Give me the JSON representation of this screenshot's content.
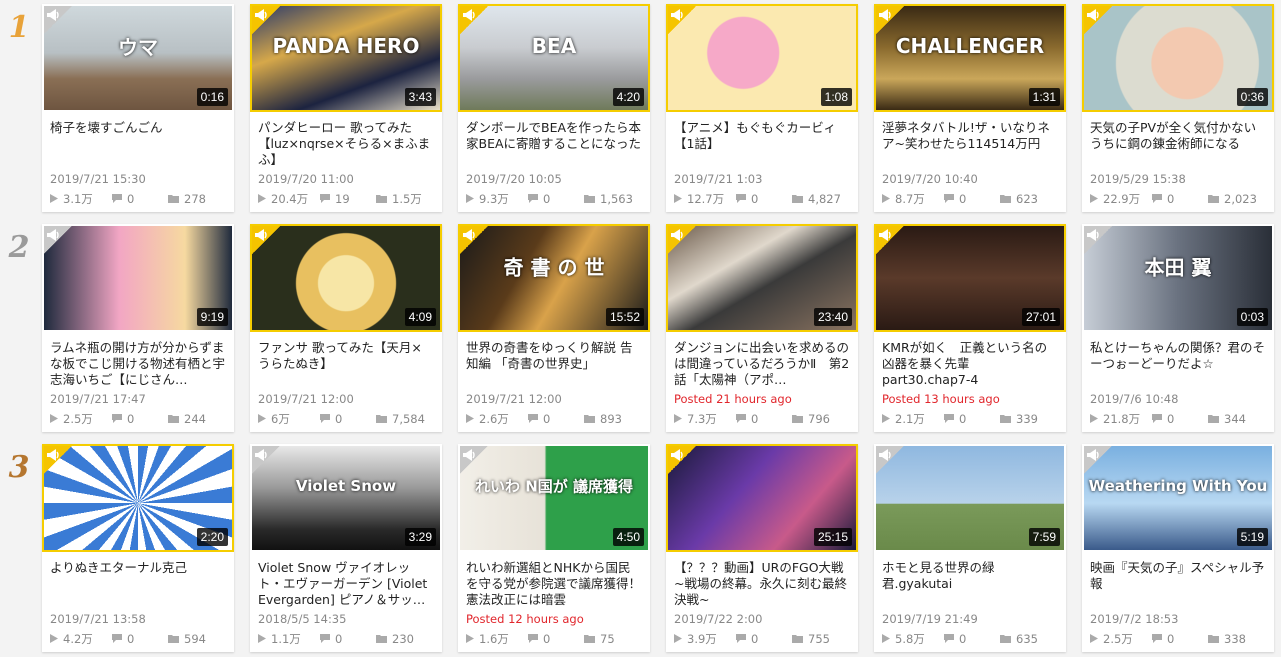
{
  "rows": [
    {
      "rank": "1",
      "color": "#e8a239",
      "cards": [
        {
          "title": "椅子を壊すごんごん",
          "date": "2019/7/21 15:30",
          "views": "3.1万",
          "comments": "0",
          "mylists": "278",
          "duration": "0:16",
          "ad": false,
          "new": false,
          "bg": "linear-gradient(180deg,#cfd8dc 0%,#b8c0c4 45%,#8a6f55 70%,#6e5540 100%)",
          "thumb_text": "ウマ",
          "icon": "megaphone-icon"
        },
        {
          "title": "パンダヒーロー 歌ってみた【luz×nqrse×そらる×まふまふ】",
          "date": "2019/7/20 11:00",
          "views": "20.4万",
          "comments": "19",
          "mylists": "1.5万",
          "duration": "3:43",
          "ad": true,
          "new": false,
          "bg": "linear-gradient(160deg,#2b3a6a 0%,#d6a84a 35%,#1c2340 70%,#e9e0c9 100%)",
          "thumb_text": "PANDA HERO",
          "icon": "megaphone-icon"
        },
        {
          "title": "ダンボールでBEAを作ったら本家BEAに寄贈することになった",
          "date": "2019/7/20 10:05",
          "views": "9.3万",
          "comments": "0",
          "mylists": "1,563",
          "duration": "4:20",
          "ad": true,
          "new": false,
          "bg": "linear-gradient(180deg,#dfe6ec 0%,#c9ccd0 40%,#9a9b9d 70%,#6f7a5a 100%)",
          "thumb_text": "BEA",
          "icon": "megaphone-icon"
        },
        {
          "title": "【アニメ】もぐもぐカービィ【1話】",
          "date": "2019/7/21 1:03",
          "views": "12.7万",
          "comments": "0",
          "mylists": "4,827",
          "duration": "1:08",
          "ad": true,
          "new": false,
          "bg": "radial-gradient(circle at 40% 45%,#f6a9c8 0 28%,#fbe9b0 29% 100%)",
          "thumb_text": "",
          "icon": "megaphone-icon"
        },
        {
          "title": "淫夢ネタバトル!ザ・いなりネア~笑わせたら114514万円",
          "date": "2019/7/20 10:40",
          "views": "8.7万",
          "comments": "0",
          "mylists": "623",
          "duration": "1:31",
          "ad": true,
          "new": false,
          "bg": "linear-gradient(180deg,#3a2a14 0%,#8a6a2e 40%,#caa75a 70%,#3a2a14 100%)",
          "thumb_text": "CHALLENGER",
          "icon": "megaphone-icon"
        },
        {
          "title": "天気の子PVが全く気付かないうちに鋼の錬金術師になる",
          "date": "2019/5/29 15:38",
          "views": "22.9万",
          "comments": "0",
          "mylists": "2,023",
          "duration": "0:36",
          "ad": true,
          "new": false,
          "bg": "radial-gradient(circle at 55% 55%,#f3c9b0 0 30%,#dcdcd0 31% 60%,#a9c4c8 61% 100%)",
          "thumb_text": "",
          "icon": "megaphone-icon"
        }
      ]
    },
    {
      "rank": "2",
      "color": "#9a9a9a",
      "cards": [
        {
          "title": "ラムネ瓶の開け方が分からずまな板でこじ開ける物述有栖と宇志海いちご【にじさん…",
          "date": "2019/7/21 17:47",
          "views": "2.5万",
          "comments": "0",
          "mylists": "244",
          "duration": "9:19",
          "ad": false,
          "new": false,
          "bg": "linear-gradient(90deg,#1f2a3d 0%,#f2a6c4 40%,#f6d9a0 75%,#1f2a3d 100%)",
          "thumb_text": "",
          "icon": "megaphone-icon"
        },
        {
          "title": "ファンサ 歌ってみた【天月×うらたぬき】",
          "date": "2019/7/21 12:00",
          "views": "6万",
          "comments": "0",
          "mylists": "7,584",
          "duration": "4:09",
          "ad": true,
          "new": false,
          "bg": "radial-gradient(circle at 50% 55%,#f7e6a6 0 25%,#e8c060 26% 45%,#2a2f1c 46% 100%)",
          "thumb_text": "",
          "icon": "megaphone-icon"
        },
        {
          "title": "世界の奇書をゆっくり解説 告知編 「奇書の世界史」",
          "date": "2019/7/21 12:00",
          "views": "2.6万",
          "comments": "0",
          "mylists": "893",
          "duration": "15:52",
          "ad": true,
          "new": false,
          "bg": "linear-gradient(120deg,#1a1a1a 0%,#5a3b1a 35%,#d9a24a 55%,#1a1a1a 100%)",
          "thumb_text": "奇 書 の 世",
          "icon": "megaphone-icon"
        },
        {
          "title": "ダンジョンに出会いを求めるのは間違っているだろうかⅡ　第2話「太陽神（アポ…",
          "date": "Posted 21 hours ago",
          "views": "7.3万",
          "comments": "0",
          "mylists": "796",
          "duration": "23:40",
          "ad": true,
          "new": true,
          "bg": "linear-gradient(150deg,#6b5a4a 0%,#e0d8cc 35%,#3a3a3a 55%,#8a7360 100%)",
          "thumb_text": "",
          "icon": "megaphone-icon"
        },
        {
          "title": "KMRが如く　正義という名の凶器を暴く先輩 part30.chap7-4",
          "date": "Posted 13 hours ago",
          "views": "2.1万",
          "comments": "0",
          "mylists": "339",
          "duration": "27:01",
          "ad": true,
          "new": true,
          "bg": "linear-gradient(180deg,#2a1a14 0%,#5a3a2a 50%,#2a1a14 100%)",
          "thumb_text": "",
          "icon": "megaphone-icon"
        },
        {
          "title": "私とけーちゃんの関係？君のそーつぉーどーりだよ☆",
          "date": "2019/7/6 10:48",
          "views": "21.8万",
          "comments": "0",
          "mylists": "344",
          "duration": "0:03",
          "ad": false,
          "new": false,
          "bg": "linear-gradient(90deg,#c6cdd6 0%,#6a7280 50%,#2a2f38 100%)",
          "thumb_text": "本田 翼",
          "icon": "megaphone-icon"
        }
      ]
    },
    {
      "rank": "3",
      "color": "#b5762f",
      "cards": [
        {
          "title": "よりぬきエターナル克己",
          "date": "2019/7/21 13:58",
          "views": "4.2万",
          "comments": "0",
          "mylists": "594",
          "duration": "2:20",
          "ad": true,
          "new": false,
          "bg": "repeating-conic-gradient(from 0deg at 50% 55%,#3a7bd5 0deg 10deg,#ffffff 10deg 20deg)",
          "thumb_text": "",
          "icon": "megaphone-icon"
        },
        {
          "title": "Violet Snow ヴァイオレット・エヴァーガーデン [Violet Evergarden] ピアノ＆サッ…",
          "date": "2018/5/5 14:35",
          "views": "1.1万",
          "comments": "0",
          "mylists": "230",
          "duration": "3:29",
          "ad": false,
          "new": false,
          "bg": "linear-gradient(180deg,#e8e8e8 0%,#9a9a9a 40%,#2a2a2a 80%,#111 100%)",
          "thumb_text": "Violet Snow",
          "icon": "megaphone-icon"
        },
        {
          "title": "れいわ新選組とNHKから国民を守る党が参院選で議席獲得！憲法改正には暗雲",
          "date": "Posted 12 hours ago",
          "views": "1.6万",
          "comments": "0",
          "mylists": "75",
          "duration": "4:50",
          "ad": false,
          "new": true,
          "bg": "linear-gradient(90deg,#f2efe8 0%,#e7e2d8 45%,#2ea04a 46%,#2ea04a 100%)",
          "thumb_text": "れいわ N国が 議席獲得",
          "icon": "megaphone-icon"
        },
        {
          "title": "【？？？動画】URのFGO大戦~戦場の終幕。永久に刻む最終決戦~",
          "date": "2019/7/22 2:00",
          "views": "3.9万",
          "comments": "0",
          "mylists": "755",
          "duration": "25:15",
          "ad": true,
          "new": false,
          "bg": "linear-gradient(130deg,#1a1a3a 0%,#6a3aa8 40%,#c85a8a 70%,#1a1a3a 100%)",
          "thumb_text": "",
          "icon": "megaphone-icon"
        },
        {
          "title": "ホモと見る世界の緑君.gyakutai",
          "date": "2019/7/19 21:49",
          "views": "5.8万",
          "comments": "0",
          "mylists": "635",
          "duration": "7:59",
          "ad": false,
          "new": false,
          "bg": "linear-gradient(180deg,#8fb8e0 0%,#b8d2ea 55%,#7a9a5a 56%,#6a8a4a 100%)",
          "thumb_text": "",
          "icon": "megaphone-icon"
        },
        {
          "title": "映画『天気の子』スペシャル予報",
          "date": "2019/7/2 18:53",
          "views": "2.5万",
          "comments": "0",
          "mylists": "338",
          "duration": "5:19",
          "ad": false,
          "new": false,
          "bg": "linear-gradient(180deg,#7ab0e0 0%,#b8d8f2 55%,#3a5a8a 100%)",
          "thumb_text": "Weathering With You",
          "icon": "megaphone-icon"
        }
      ]
    }
  ]
}
